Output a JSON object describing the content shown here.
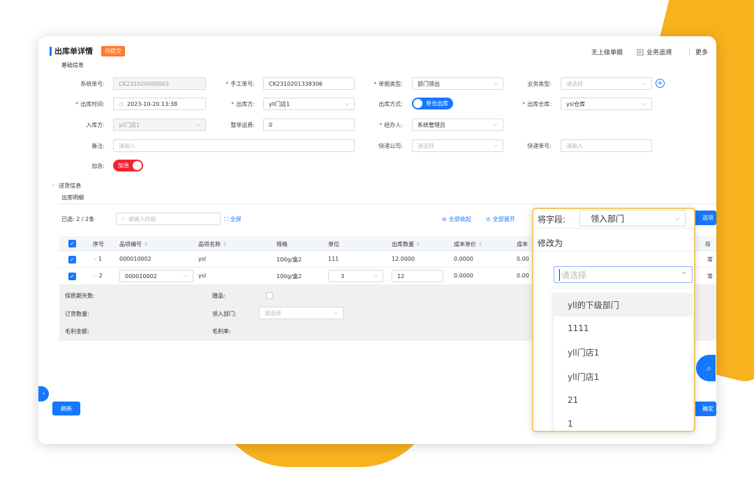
{
  "header": {
    "title": "出库单详情",
    "status": "待提交",
    "link_no_parent": "无上级单据",
    "link_trace": "业务追溯",
    "link_more": "更多"
  },
  "sections": {
    "basic": "基础信息",
    "shipping": "送货信息",
    "details": "出库明细"
  },
  "form": {
    "sys_no_label": "系统单号:",
    "sys_no_value": "CK231020000003",
    "manual_no_label": "手工单号:",
    "manual_no_value": "CK2310201338306",
    "doc_type_label": "单据类型:",
    "doc_type_value": "部门领出",
    "biz_type_label": "业务类型:",
    "biz_type_placeholder": "请选择",
    "out_time_label": "出库时间:",
    "out_time_value": "2023-10-20 13:38",
    "out_party_label": "出库方:",
    "out_party_value": "yll门店1",
    "out_method_label": "出库方式:",
    "out_method_value": "单仓出库",
    "out_wh_label": "出库仓库:",
    "out_wh_value": "ysl仓库",
    "in_party_label": "入库方:",
    "in_party_value": "yll门店1",
    "freight_label": "整单运费:",
    "freight_value": "0",
    "handler_label": "经办人:",
    "handler_value": "系统管理员",
    "remark_label": "备注:",
    "remark_placeholder": "请输入",
    "express_co_label": "快递公司:",
    "express_co_placeholder": "请选择",
    "express_no_label": "快递单号:",
    "express_no_placeholder": "请输入",
    "urgent_label": "加急:",
    "urgent_value": "加急"
  },
  "toolbar": {
    "selected": "已选: 2 / 2条",
    "search_placeholder": "请输入内容",
    "fullscreen": "全屏",
    "collapse_all": "全部收起",
    "expand_all": "全部展开",
    "edge_btn": "选项",
    "refresh": "刷新",
    "edge_btn2": "确定"
  },
  "table": {
    "headers": [
      "序号",
      "品项编号",
      "品项名称",
      "规格",
      "单位",
      "出库数量",
      "成本单价",
      "成本",
      "存"
    ],
    "rows": [
      {
        "seq": "1",
        "code": "000010002",
        "name": "ysl",
        "spec": "100g/盒2",
        "unit": "111",
        "qty": "12.0000",
        "price": "0.0000",
        "cost": "0.00",
        "tail": "常"
      },
      {
        "seq": "2",
        "code": "000010002",
        "name": "ysl",
        "spec": "100g/盒2",
        "unit": "3",
        "qty": "12",
        "price": "0.0000",
        "cost": "0.00",
        "tail": "常"
      }
    ]
  },
  "detail": {
    "shelf_days": "保质期天数:",
    "gift": "赠品:",
    "order_qty": "订货数量:",
    "dept": "领入部门:",
    "dept_placeholder": "请选择",
    "gross_amount": "毛利金额:",
    "gross_rate": "毛利率:"
  },
  "popup": {
    "field_label": "将字段:",
    "field_value": "领入部门",
    "change_to": "修改为",
    "select_placeholder": "请选择",
    "options": [
      "yll的下级部门",
      "1111",
      "yll门店1",
      "yll门店1",
      "21",
      "1"
    ]
  },
  "colors": {
    "primary": "#1677ff",
    "badge": "#ff7a2e",
    "urgent": "#f5222d",
    "accent_bg": "#f7b21e"
  }
}
